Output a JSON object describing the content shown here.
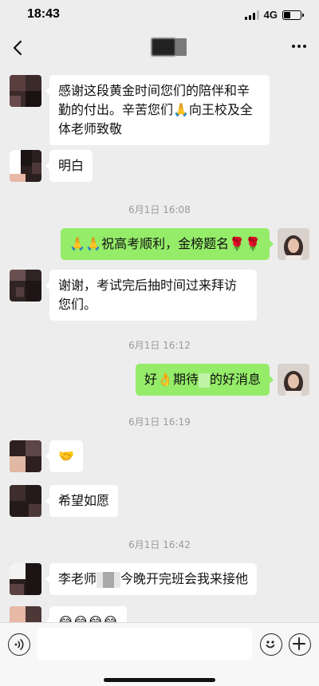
{
  "status_bar": {
    "time": "18:43",
    "network": "4G",
    "battery_level": 0.4
  },
  "nav": {
    "back_icon": "chevron-left-icon",
    "more_icon": "more-dots-icon"
  },
  "messages": [
    {
      "from": "contact",
      "text": "感谢这段黄金时间您们的陪伴和辛勤的付出。辛苦您们🙏向王校及全体老师致敬"
    },
    {
      "from": "contact",
      "text": "明白"
    },
    {
      "timestamp": "6月1日 16:08"
    },
    {
      "from": "me",
      "text": "🙏🙏祝高考顺利，金榜题名🌹🌹"
    },
    {
      "from": "contact",
      "text": "谢谢，考试完后抽时间过来拜访您们。"
    },
    {
      "timestamp": "6月1日 16:12"
    },
    {
      "from": "me",
      "text_before": "好👌期待",
      "text_after": "的好消息"
    },
    {
      "timestamp": "6月1日 16:19"
    },
    {
      "from": "contact",
      "text": "🤝"
    },
    {
      "from": "contact",
      "text": "希望如愿"
    },
    {
      "timestamp": "6月1日 16:42"
    },
    {
      "from": "contact",
      "text_before": "李老师",
      "text_after": "今晚开完班会我来接他"
    },
    {
      "from": "contact",
      "text": "😂😂😂😂"
    }
  ],
  "input_bar": {
    "placeholder": "",
    "voice_icon": "voice-icon",
    "emoji_icon": "emoji-icon",
    "plus_icon": "plus-icon"
  },
  "colors": {
    "background": "#ededed",
    "incoming_bubble": "#ffffff",
    "outgoing_bubble": "#95ec69",
    "timestamp_text": "#9a9a9a"
  }
}
